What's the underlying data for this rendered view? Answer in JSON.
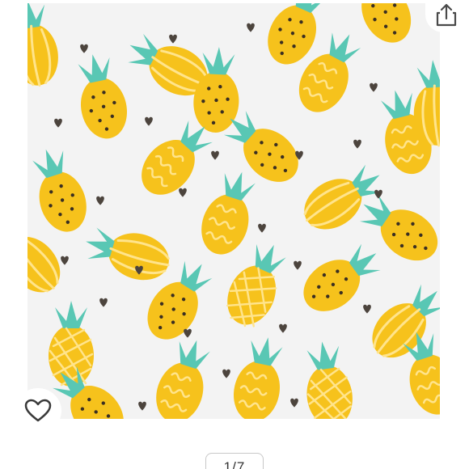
{
  "product_image": {
    "background": "#f3f3f3",
    "fruit_body_color": "#f6c21c",
    "fruit_leaf_color": "#59c7b4",
    "dot_color": "#3b2f22",
    "heart_color": "#4c443d"
  },
  "share": {
    "icon": "share-icon"
  },
  "wishlist": {
    "icon": "heart-outline-icon"
  },
  "pagination": {
    "label": "1/7"
  }
}
